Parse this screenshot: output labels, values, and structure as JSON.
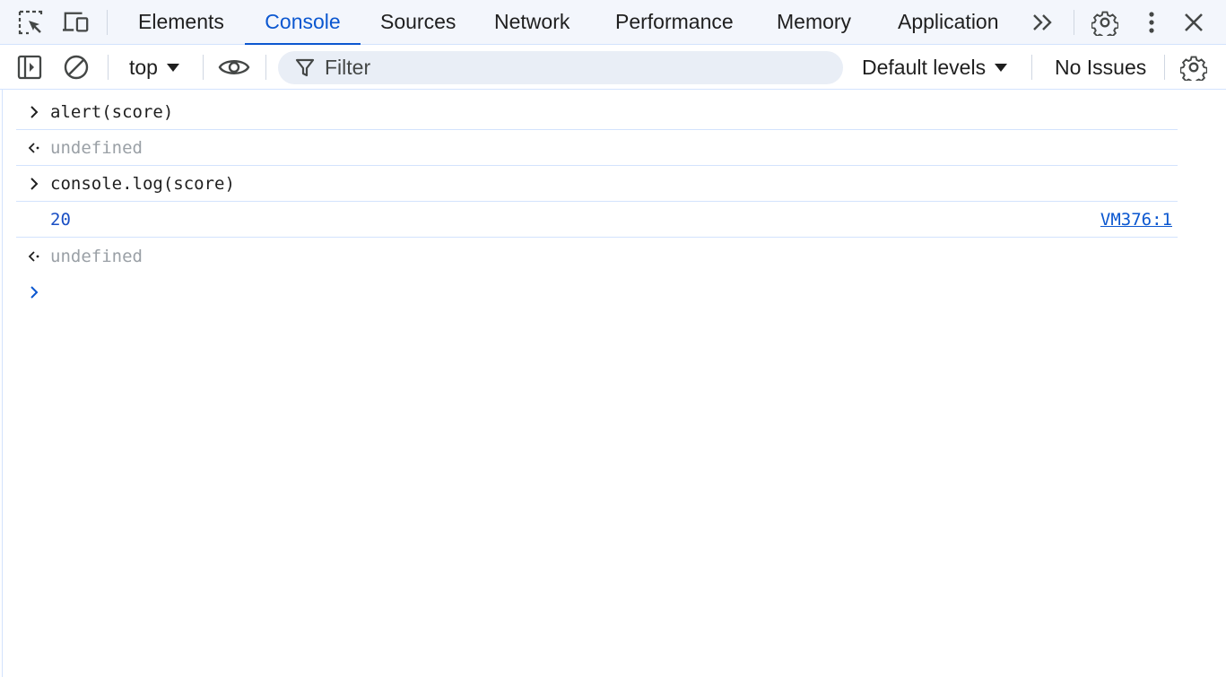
{
  "tabs": [
    {
      "label": "Elements",
      "active": false
    },
    {
      "label": "Console",
      "active": true
    },
    {
      "label": "Sources",
      "active": false
    },
    {
      "label": "Network",
      "active": false
    },
    {
      "label": "Performance",
      "active": false
    },
    {
      "label": "Memory",
      "active": false
    },
    {
      "label": "Application",
      "active": false
    }
  ],
  "toolbar": {
    "context": "top",
    "filter_placeholder": "Filter",
    "levels": "Default levels",
    "issues": "No Issues"
  },
  "console": {
    "entries": [
      {
        "type": "input",
        "text": "alert(score)"
      },
      {
        "type": "result",
        "text": "undefined"
      },
      {
        "type": "input",
        "text": "console.log(score)"
      },
      {
        "type": "log",
        "text": "20",
        "source": "VM376:1"
      },
      {
        "type": "result",
        "text": "undefined"
      }
    ]
  },
  "colors": {
    "accent": "#0b57d0",
    "tabbar_bg": "#f3f6fc",
    "filter_bg": "#e9eef6",
    "muted": "#9aa0a6",
    "log_number": "#1a4fc4"
  },
  "icons": [
    "inspect-element-icon",
    "device-toolbar-icon",
    "more-tabs-icon",
    "settings-gear-icon",
    "more-vert-icon",
    "close-icon",
    "sidebar-toggle-icon",
    "clear-console-icon",
    "eye-icon",
    "filter-icon",
    "console-settings-icon"
  ]
}
